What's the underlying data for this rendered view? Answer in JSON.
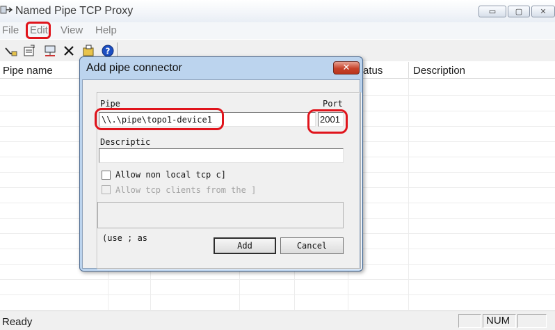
{
  "window": {
    "title": "Named Pipe TCP Proxy",
    "controls": {
      "minimize": "▭",
      "maximize": "▢",
      "close": "✕"
    }
  },
  "menu": [
    "File",
    "Edit",
    "View",
    "Help"
  ],
  "toolbar": {
    "icons": [
      "add-pipe-icon",
      "properties-icon",
      "network-icon",
      "delete-icon",
      "folder-icon",
      "help-icon"
    ]
  },
  "list": {
    "columns": [
      "Pipe name",
      "Status",
      "Description"
    ],
    "visible_status_fragment": "atus"
  },
  "status_bar": {
    "text": "Ready",
    "num": "NUM"
  },
  "dialog": {
    "title": "Add pipe connector",
    "close": "✕",
    "pipe_label": "Pipe",
    "pipe_value": "\\\\.\\pipe\\topo1-device1",
    "port_label": "Port",
    "port_value": "2001",
    "description_label": "Descriptic",
    "description_value": "",
    "allow_non_local_label": "Allow non local tcp c]",
    "allow_clients_label": "Allow tcp clients from the ]",
    "hint_text": "(use ; as",
    "add_button": "Add",
    "cancel_button": "Cancel"
  },
  "highlight_color": "#e0141c"
}
